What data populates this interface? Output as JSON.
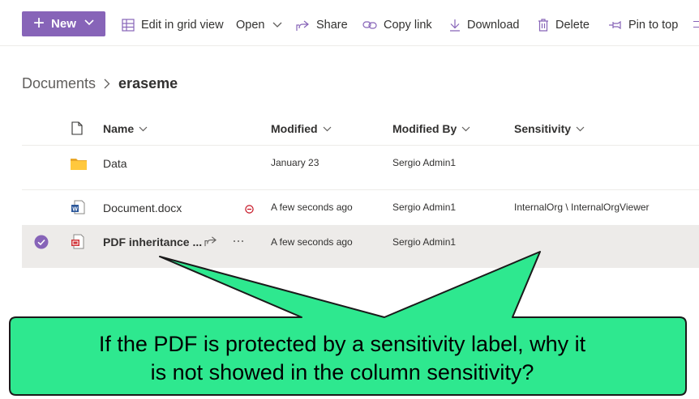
{
  "toolbar": {
    "new_label": "New",
    "edit_grid_label": "Edit in grid view",
    "open_label": "Open",
    "share_label": "Share",
    "copy_link_label": "Copy link",
    "download_label": "Download",
    "delete_label": "Delete",
    "pin_label": "Pin to top"
  },
  "breadcrumb": {
    "root": "Documents",
    "current": "eraseme"
  },
  "columns": {
    "name": "Name",
    "modified": "Modified",
    "modified_by": "Modified By",
    "sensitivity": "Sensitivity"
  },
  "rows": [
    {
      "name": "Data",
      "modified": "January 23",
      "modified_by": "Sergio Admin1",
      "sensitivity": ""
    },
    {
      "name": "Document.docx",
      "modified": "A few seconds ago",
      "modified_by": "Sergio Admin1",
      "sensitivity": "InternalOrg \\ InternalOrgViewer"
    },
    {
      "name": "PDF inheritance ...",
      "modified": "A few seconds ago",
      "modified_by": "Sergio Admin1",
      "sensitivity": ""
    }
  ],
  "callout": {
    "line1": "If the PDF is protected by a sensitivity label, why it",
    "line2": "is not showed in the column sensitivity?"
  },
  "colors": {
    "accent": "#8764b8",
    "callout_fill": "#2ee88f",
    "selected_row": "#edebe9"
  }
}
